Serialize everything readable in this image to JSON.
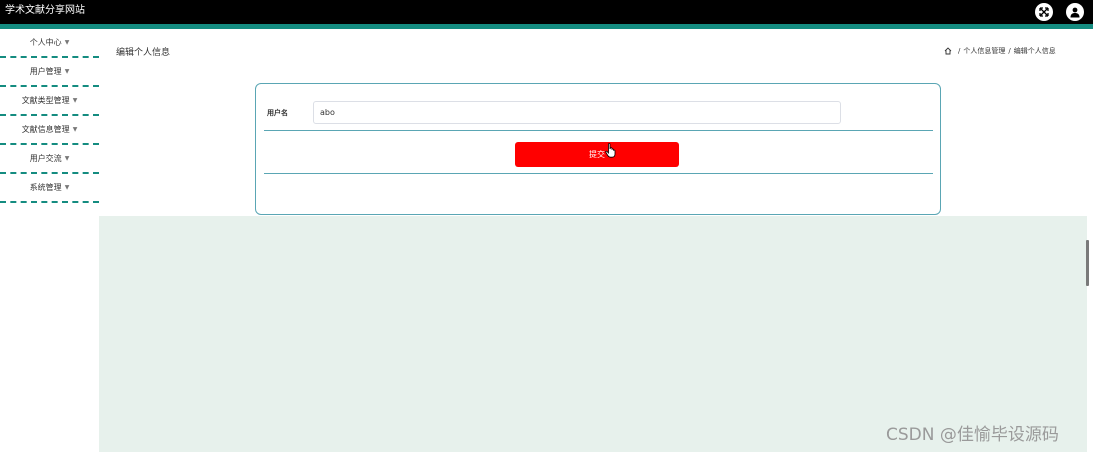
{
  "header": {
    "site_title": "学术文献分享网站",
    "fullscreen_icon": "fullscreen-toggle-icon",
    "user_icon": "user-avatar-icon"
  },
  "sidebar": {
    "items": [
      {
        "label": "个人中心"
      },
      {
        "label": "用户管理"
      },
      {
        "label": "文献类型管理"
      },
      {
        "label": "文献信息管理"
      },
      {
        "label": "用户交流"
      },
      {
        "label": "系统管理"
      }
    ],
    "caret_icon": "chevron-down-icon"
  },
  "page": {
    "title": "编辑个人信息",
    "breadcrumb": {
      "home_icon": "home-icon",
      "separator": "/",
      "items": [
        "个人信息管理",
        "编辑个人信息"
      ]
    }
  },
  "form": {
    "username_label": "用户名",
    "username_value": "abo",
    "submit_label": "提交"
  },
  "watermark": "CSDN @佳愉毕设源码",
  "colors": {
    "accent": "#148c80",
    "card_border": "#5aa6b4",
    "submit": "#ff0000",
    "content_bg": "#e7f1ec"
  }
}
